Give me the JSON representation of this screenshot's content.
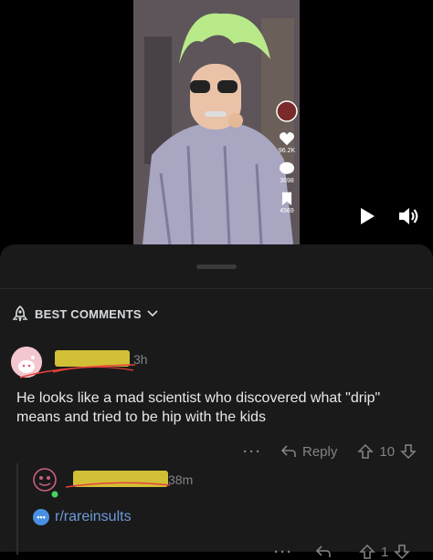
{
  "video": {
    "likes": "96.2K",
    "comments": "3698",
    "shares": "4569"
  },
  "sort": {
    "label": "BEST COMMENTS"
  },
  "comment1": {
    "username": "",
    "time": "3h",
    "text": "He looks like a mad scientist who discovered what \"drip\" means and tried to be hip with the kids",
    "reply_label": "Reply",
    "score": "10"
  },
  "comment2": {
    "username": "",
    "time": "38m",
    "subreddit": "r/rareinsults",
    "score": "1"
  }
}
